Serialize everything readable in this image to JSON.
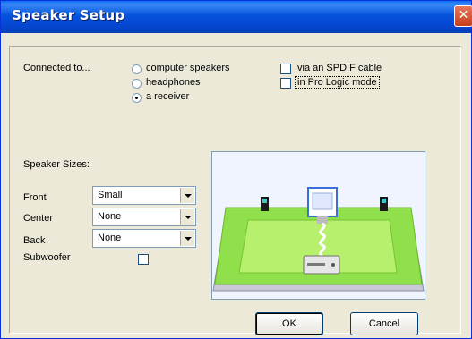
{
  "window": {
    "title": "Speaker Setup"
  },
  "connection": {
    "label": "Connected to...",
    "options": [
      {
        "label": "computer speakers",
        "selected": false
      },
      {
        "label": "headphones",
        "selected": false
      },
      {
        "label": "a receiver",
        "selected": true
      }
    ]
  },
  "options": {
    "spdif": {
      "label": "via an SPDIF cable",
      "checked": false
    },
    "prologic": {
      "label": "in Pro Logic mode",
      "checked": false
    }
  },
  "sizes": {
    "heading": "Speaker Sizes:",
    "front": {
      "label": "Front",
      "value": "Small"
    },
    "center": {
      "label": "Center",
      "value": "None"
    },
    "back": {
      "label": "Back",
      "value": "None"
    },
    "subwoofer": {
      "label": "Subwoofer",
      "checked": false
    }
  },
  "buttons": {
    "ok": "OK",
    "cancel": "Cancel"
  },
  "colors": {
    "titlebar": "#0553dc",
    "room_floor": "#7ad93a",
    "face": "#ece9d8"
  },
  "icons": {
    "close": "close-icon"
  }
}
